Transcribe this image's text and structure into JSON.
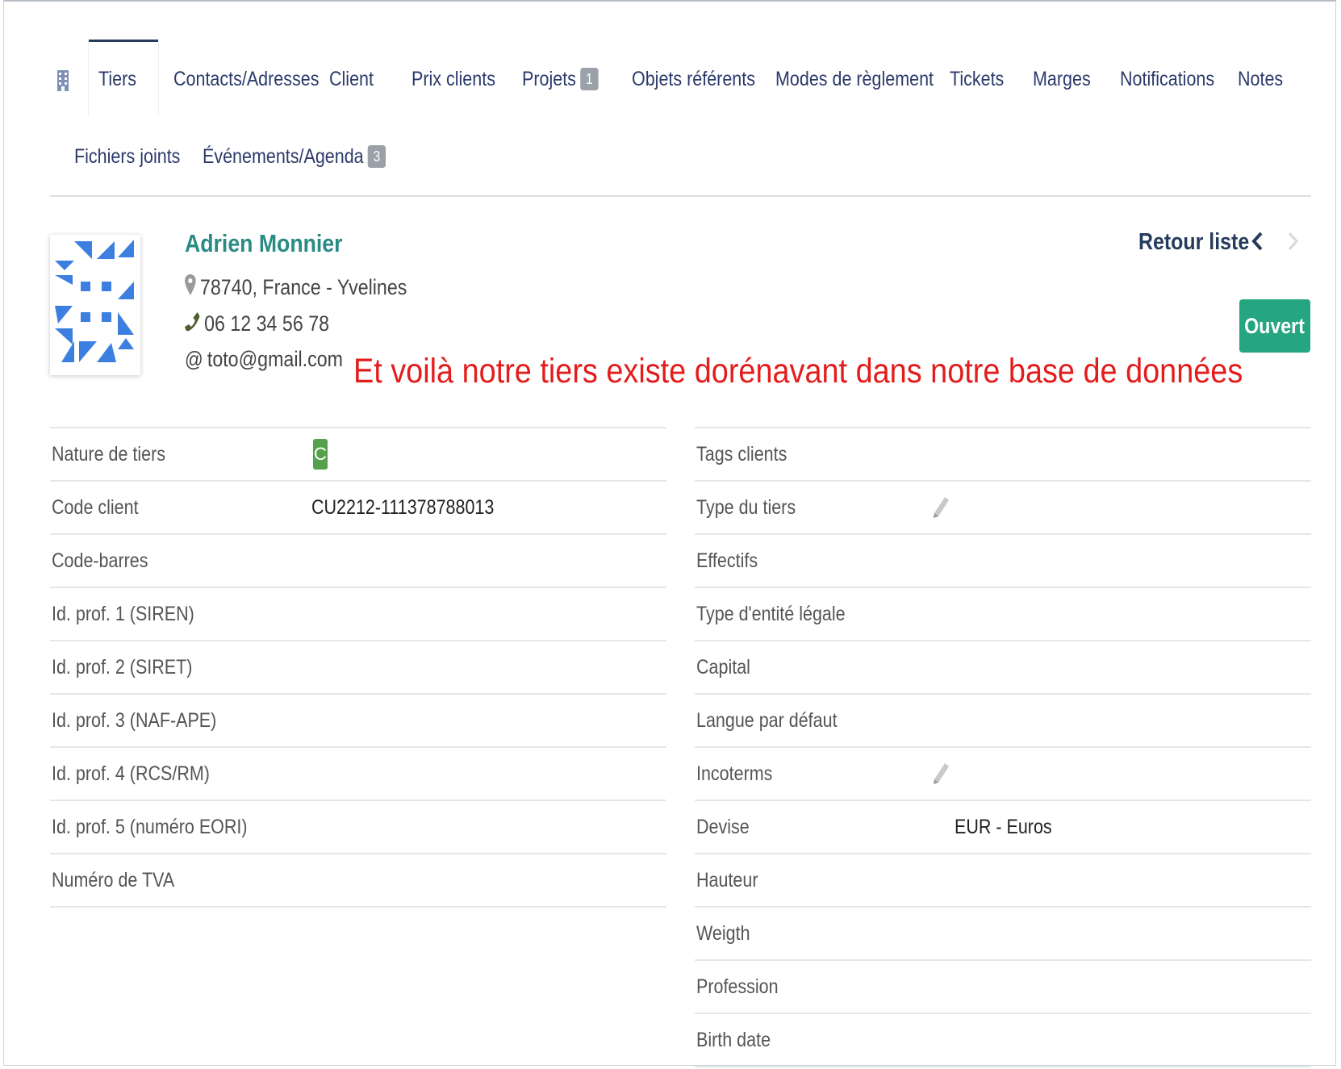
{
  "tabs": {
    "items": [
      {
        "label": "Tiers",
        "active": true
      },
      {
        "label": "Contacts/Adresses"
      },
      {
        "label": "Client"
      },
      {
        "label": "Prix clients"
      },
      {
        "label": "Projets",
        "badge": "1"
      },
      {
        "label": "Objets référents"
      },
      {
        "label": "Modes de règlement"
      },
      {
        "label": "Tickets"
      },
      {
        "label": "Marges"
      },
      {
        "label": "Notifications"
      },
      {
        "label": "Notes"
      },
      {
        "label": "Fichiers joints"
      },
      {
        "label": "Événements/Agenda",
        "badge": "3"
      }
    ],
    "icon": "building-icon"
  },
  "header": {
    "name": "Adrien Monnier",
    "address": "78740, France - Yvelines",
    "phone": "06 12 34 56 78",
    "email": "toto@gmail.com",
    "back_label": "Retour liste",
    "status": "Ouvert"
  },
  "annotation": "Et voilà notre tiers existe dorénavant dans notre base de données",
  "fields": {
    "left": [
      {
        "label": "Nature de tiers",
        "badge": "C"
      },
      {
        "label": "Code client",
        "value": "CU2212-111378788013"
      },
      {
        "label": "Code-barres",
        "value": ""
      },
      {
        "label": "Id. prof. 1 (SIREN)",
        "value": ""
      },
      {
        "label": "Id. prof. 2 (SIRET)",
        "value": ""
      },
      {
        "label": "Id. prof. 3 (NAF-APE)",
        "value": ""
      },
      {
        "label": "Id. prof. 4 (RCS/RM)",
        "value": ""
      },
      {
        "label": "Id. prof. 5 (numéro EORI)",
        "value": ""
      },
      {
        "label": "Numéro de TVA",
        "value": ""
      }
    ],
    "right": [
      {
        "label": "Tags clients",
        "value": ""
      },
      {
        "label": "Type du tiers",
        "value": "",
        "editable": true
      },
      {
        "label": "Effectifs",
        "value": ""
      },
      {
        "label": "Type d'entité légale",
        "value": ""
      },
      {
        "label": "Capital",
        "value": ""
      },
      {
        "label": "Langue par défaut",
        "value": ""
      },
      {
        "label": "Incoterms",
        "value": "",
        "editable": true
      },
      {
        "label": "Devise",
        "value": "EUR - Euros"
      },
      {
        "label": "Hauteur",
        "value": ""
      },
      {
        "label": "Weigth",
        "value": ""
      },
      {
        "label": "Profession",
        "value": ""
      },
      {
        "label": "Birth date",
        "value": ""
      }
    ]
  },
  "colors": {
    "name": "#2a8a84",
    "status_bg": "#25a580",
    "annotation": "#e31c1c",
    "badge_green": "#55a04a",
    "nav": "#263c5c"
  }
}
